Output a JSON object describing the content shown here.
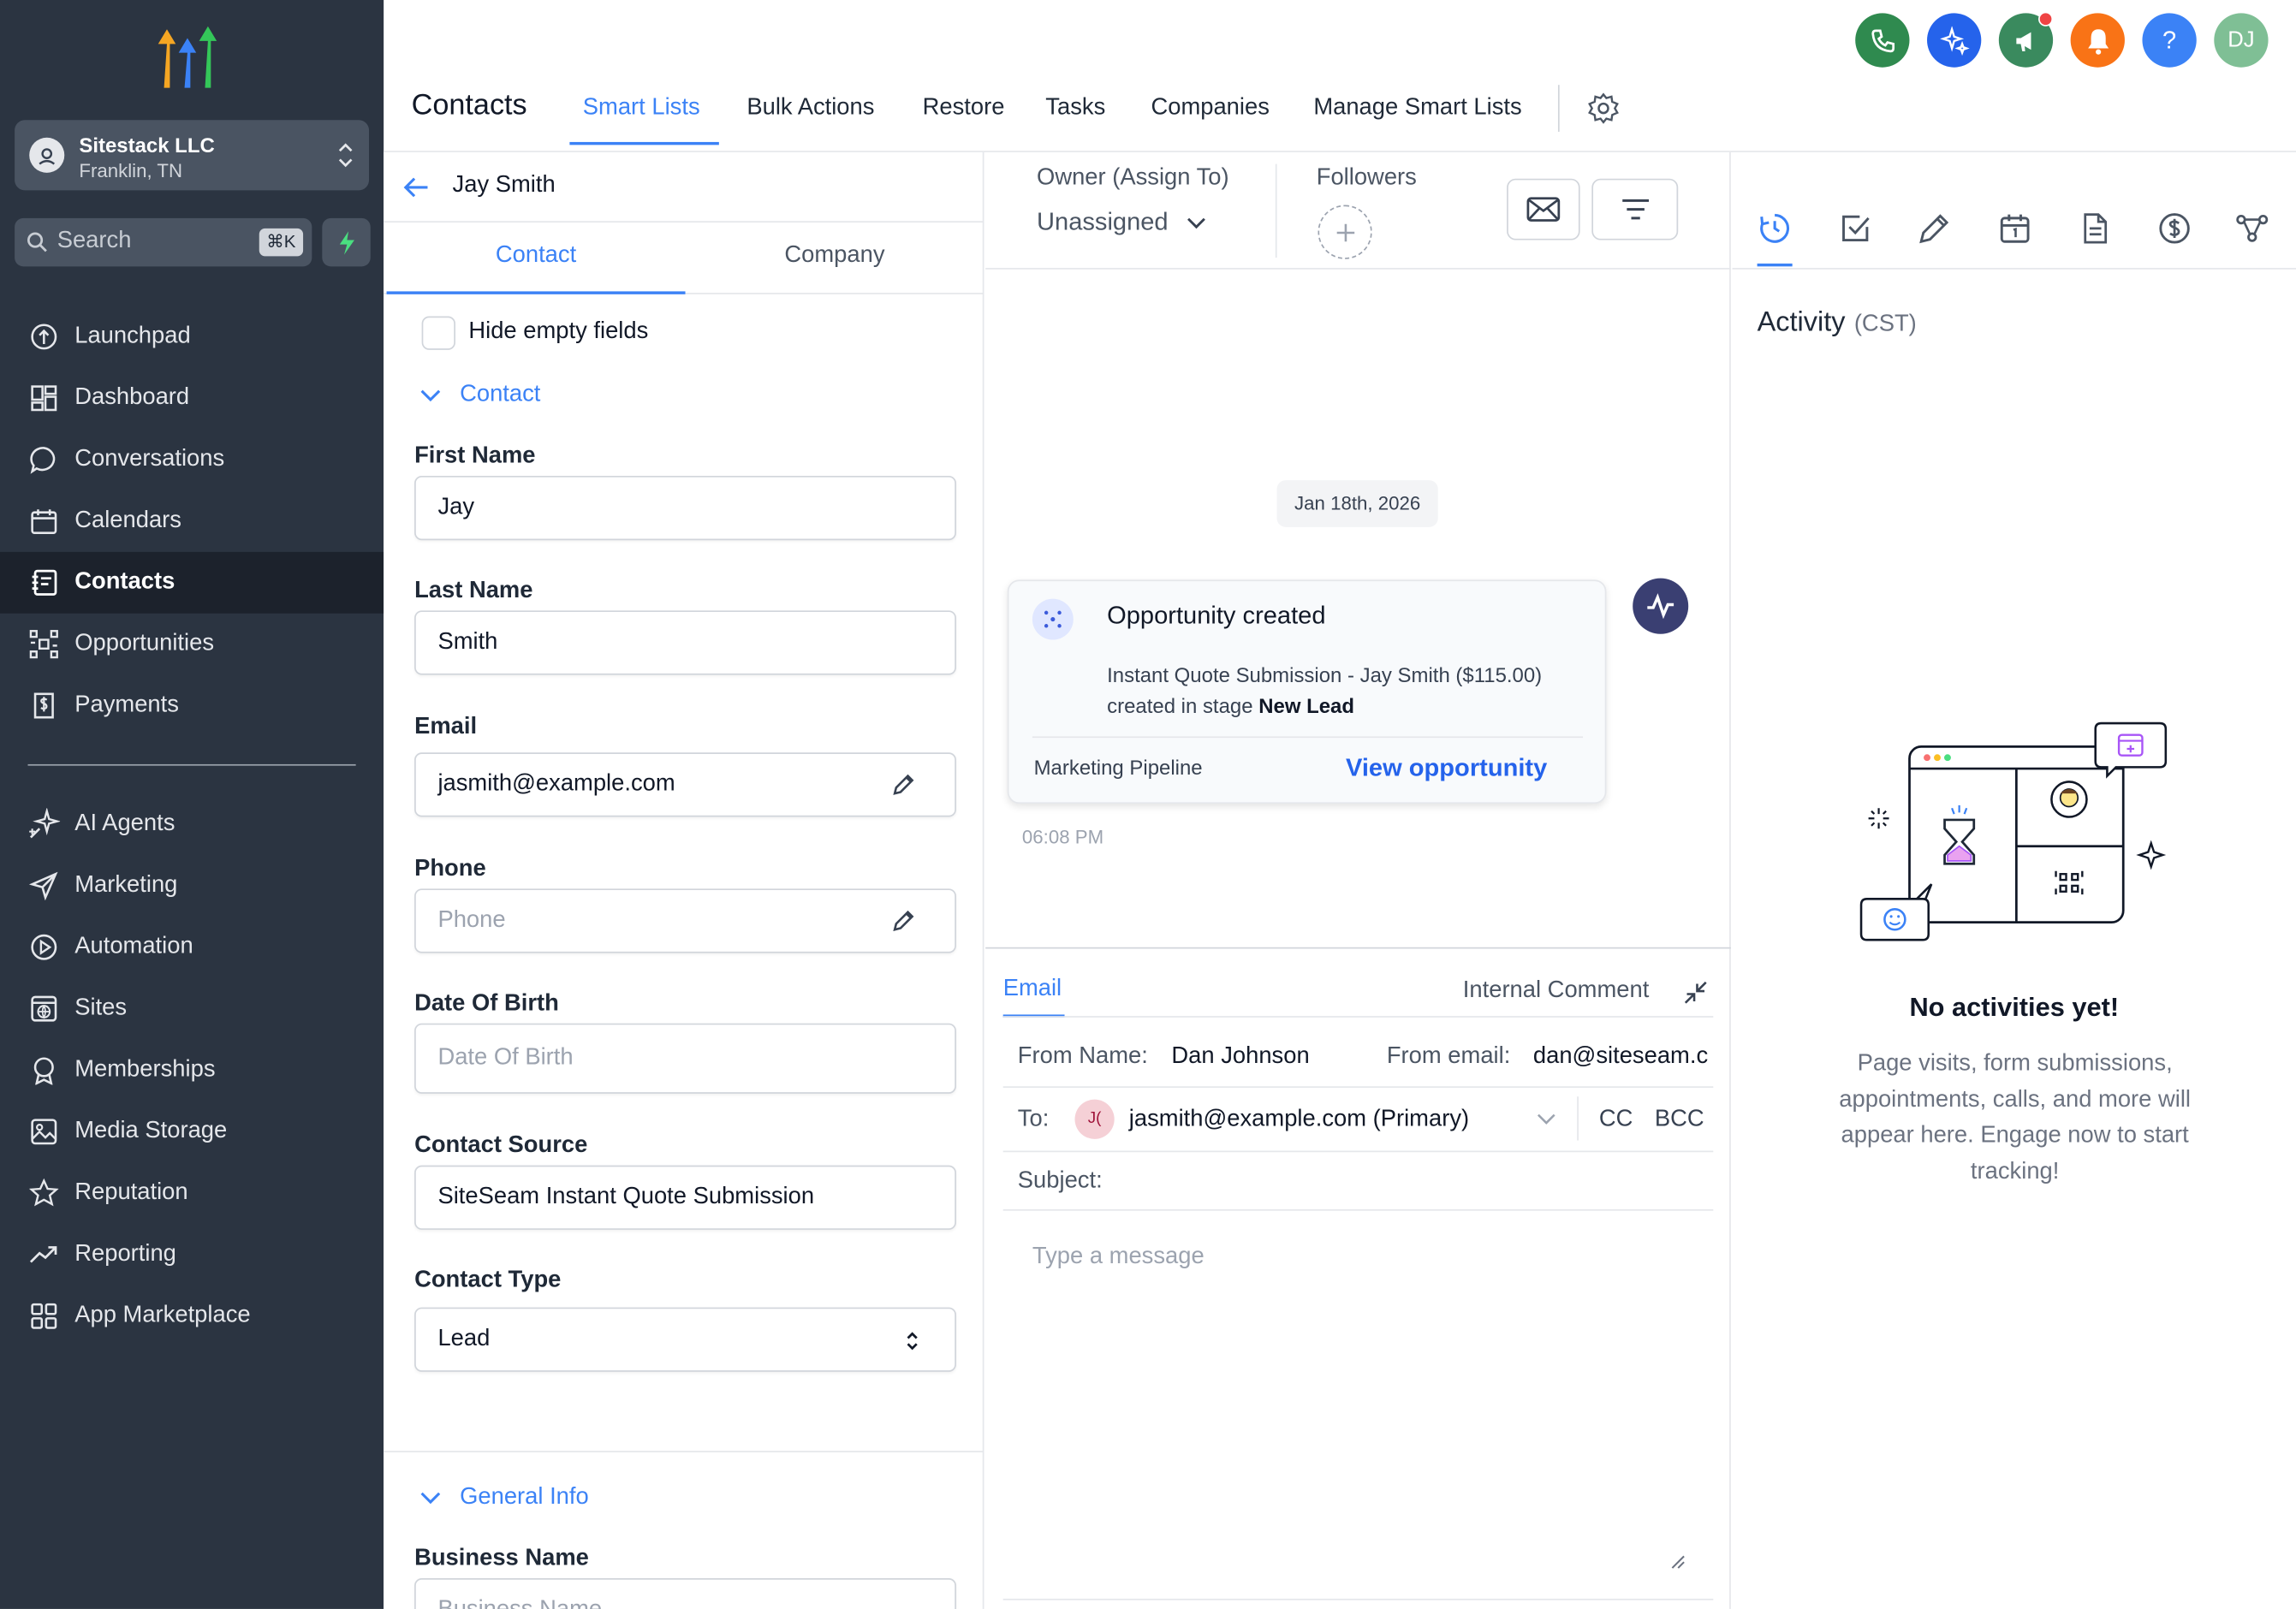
{
  "sidebar": {
    "account": {
      "name": "Sitestack LLC",
      "location": "Franklin, TN"
    },
    "search": {
      "placeholder": "Search",
      "shortcut": "⌘K"
    },
    "items": [
      {
        "label": "Launchpad",
        "icon": "launchpad-icon"
      },
      {
        "label": "Dashboard",
        "icon": "dashboard-icon"
      },
      {
        "label": "Conversations",
        "icon": "chat-bubble-icon"
      },
      {
        "label": "Calendars",
        "icon": "calendar-icon"
      },
      {
        "label": "Contacts",
        "icon": "contacts-icon",
        "active": true
      },
      {
        "label": "Opportunities",
        "icon": "opportunities-icon"
      },
      {
        "label": "Payments",
        "icon": "payments-icon"
      },
      {
        "label": "AI Agents",
        "icon": "sparkle-icon"
      },
      {
        "label": "Marketing",
        "icon": "send-icon"
      },
      {
        "label": "Automation",
        "icon": "automation-icon"
      },
      {
        "label": "Sites",
        "icon": "globe-icon"
      },
      {
        "label": "Memberships",
        "icon": "award-icon"
      },
      {
        "label": "Media Storage",
        "icon": "image-icon"
      },
      {
        "label": "Reputation",
        "icon": "star-icon"
      },
      {
        "label": "Reporting",
        "icon": "trend-icon"
      },
      {
        "label": "App Marketplace",
        "icon": "grid-icon"
      }
    ]
  },
  "topbar": {
    "title": "Contacts",
    "tabs": [
      "Smart Lists",
      "Bulk Actions",
      "Restore",
      "Tasks",
      "Companies",
      "Manage Smart Lists"
    ],
    "active_tab": "Smart Lists",
    "avatar_initials": "DJ",
    "help_label": "?",
    "colors": {
      "phone": "#2f8a4f",
      "ai": "#2563eb",
      "announce": "#3a8a5e",
      "bell": "#f97316",
      "help": "#3b82f6",
      "avatar": "#7fbf95"
    }
  },
  "contact_panel": {
    "back_name": "Jay Smith",
    "tabs": [
      "Contact",
      "Company"
    ],
    "hide_empty_label": "Hide empty fields",
    "section_contact": "Contact",
    "fields": {
      "first_name": {
        "label": "First Name",
        "value": "Jay"
      },
      "last_name": {
        "label": "Last Name",
        "value": "Smith"
      },
      "email": {
        "label": "Email",
        "value": "jasmith@example.com"
      },
      "phone": {
        "label": "Phone",
        "placeholder": "Phone"
      },
      "dob": {
        "label": "Date Of Birth",
        "placeholder": "Date Of Birth"
      },
      "source": {
        "label": "Contact Source",
        "value": "SiteSeam Instant Quote Submission"
      },
      "type": {
        "label": "Contact Type",
        "value": "Lead"
      }
    },
    "section_general": "General Info",
    "business_name": {
      "label": "Business Name",
      "placeholder": "Business Name"
    }
  },
  "conversation": {
    "owner_label": "Owner (Assign To)",
    "owner_value": "Unassigned",
    "followers_label": "Followers",
    "date_chip": "Jan 18th, 2026",
    "card": {
      "title": "Opportunity created",
      "line1": "Instant Quote Submission - Jay Smith ($115.00)",
      "line2_prefix": "created in stage",
      "stage": "New Lead",
      "pipeline": "Marketing Pipeline",
      "link": "View opportunity"
    },
    "time": "06:08 PM",
    "composer": {
      "tab_email": "Email",
      "tab_internal": "Internal Comment",
      "from_name_label": "From Name:",
      "from_name": "Dan Johnson",
      "from_email_label": "From email:",
      "from_email": "dan@siteseam.c",
      "to_label": "To:",
      "to_initials": "J(",
      "to_value": "jasmith@example.com (Primary)",
      "cc": "CC",
      "bcc": "BCC",
      "subject_label": "Subject:",
      "message_placeholder": "Type a message"
    }
  },
  "activity": {
    "title": "Activity",
    "timezone": "(CST)",
    "empty_title": "No activities yet!",
    "empty_desc": "Page visits, form submissions, appointments, calls, and more will appear here. Engage now to start tracking!"
  }
}
